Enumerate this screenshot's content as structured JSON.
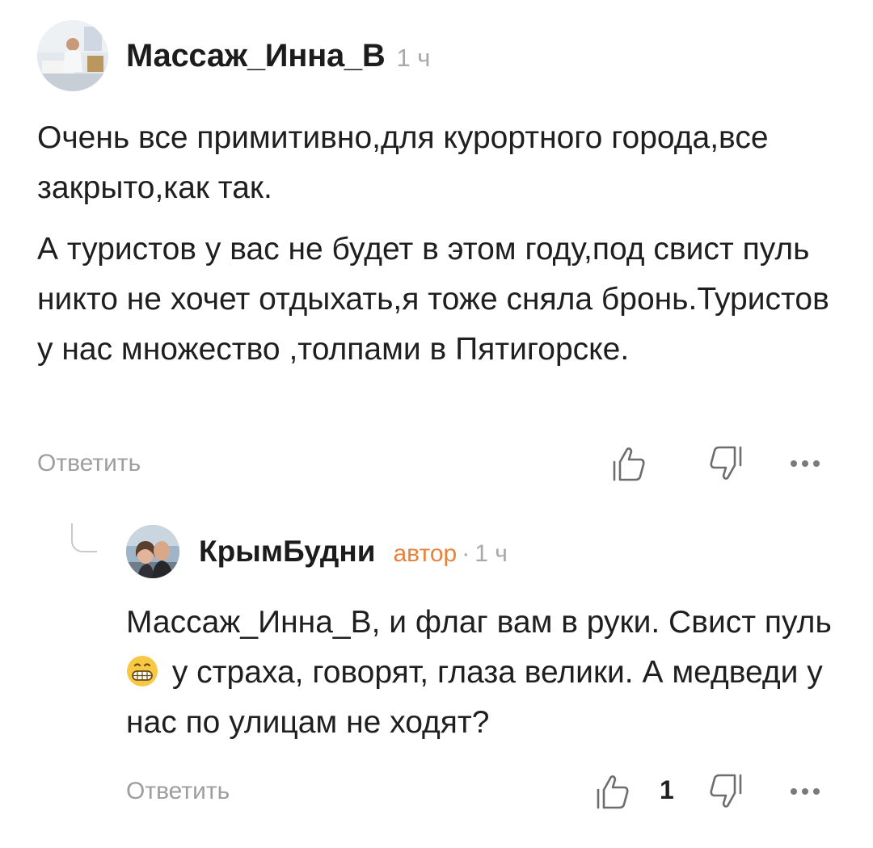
{
  "comment": {
    "author": "Массаж_Инна_В",
    "time": "1 ч",
    "paragraphs": [
      "Очень все примитивно,для курортного города,все закрыто,как так.",
      "А туристов у вас не будет в этом году,под свист пуль никто не хочет отдыхать,я тоже сняла бронь.Туристов у нас множество ,толпами в Пятигорске."
    ],
    "reply_label": "Ответить",
    "like_icon": "thumbs-up-icon",
    "dislike_icon": "thumbs-down-icon",
    "more_icon": "more-dots-icon"
  },
  "reply": {
    "author": "КрымБудни",
    "badge": "автор",
    "separator": "·",
    "time": "1 ч",
    "text_before_emoji": "Массаж_Инна_В, и флаг вам в руки. Свист пуль",
    "emoji": "grinning-face-emoji",
    "text_after_emoji": " у страха, говорят, глаза велики. А медведи у нас по улицам не ходят?",
    "reply_label": "Ответить",
    "like_count": "1",
    "like_icon": "thumbs-up-icon",
    "dislike_icon": "thumbs-down-icon",
    "more_icon": "more-dots-icon"
  },
  "colors": {
    "text": "#1f1f1f",
    "muted": "#9e9e9e",
    "author_badge": "#e8823b",
    "background": "#ffffff"
  }
}
